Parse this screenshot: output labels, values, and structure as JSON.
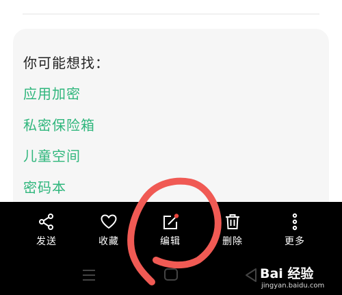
{
  "suggestions": {
    "title": "你可能想找：",
    "items": [
      "应用加密",
      "私密保险箱",
      "儿童空间",
      "密码本"
    ]
  },
  "action_bar": {
    "items": [
      {
        "label": "发送",
        "icon": "share-icon"
      },
      {
        "label": "收藏",
        "icon": "heart-icon"
      },
      {
        "label": "编辑",
        "icon": "edit-icon",
        "badge": true
      },
      {
        "label": "删除",
        "icon": "trash-icon"
      },
      {
        "label": "更多",
        "icon": "more-vertical-icon"
      }
    ]
  },
  "nav_bar": {
    "items": [
      "menu-icon",
      "home-icon",
      "back-icon"
    ]
  },
  "watermark": {
    "logo": "Bai 经验",
    "url": "jingyan.baidu.com"
  },
  "colors": {
    "link": "#2fb67c",
    "annotation": "#f05a54",
    "badge": "#e8453c",
    "bar": "#000000"
  }
}
